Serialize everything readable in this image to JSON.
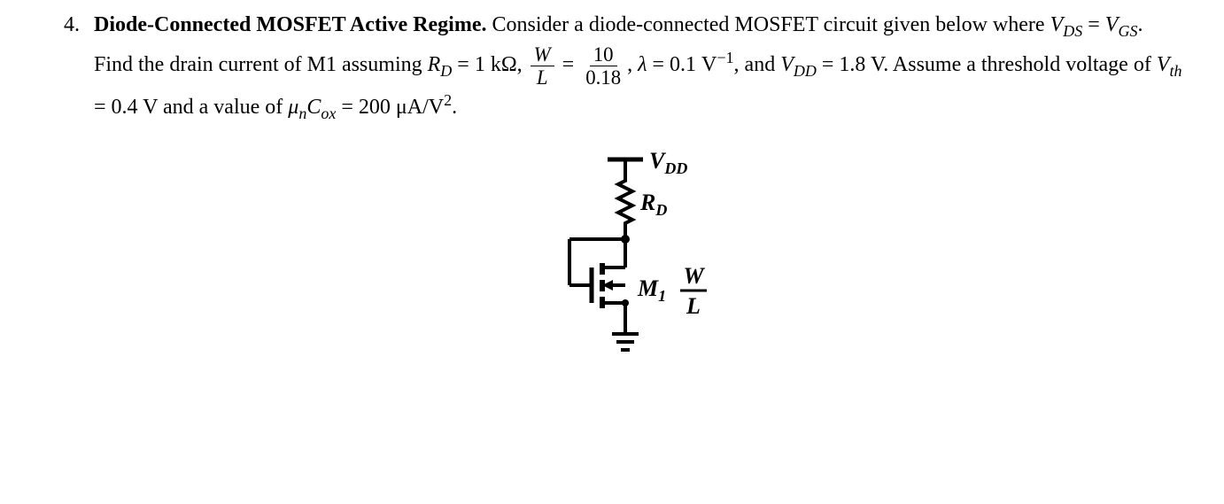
{
  "problem": {
    "number": "4.",
    "title": "Diode-Connected MOSFET Active Regime.",
    "intro_text": " Consider a diode-connected MOSFET circuit given below where ",
    "vds": "V",
    "vds_sub": "DS",
    "vgs": "V",
    "vgs_sub": "GS",
    "text2": ". Find the drain current of M1 assuming ",
    "rd": "R",
    "rd_sub": "D",
    "rd_val": " = 1 kΩ, ",
    "wl_num": "W",
    "wl_den": "L",
    "wl_eq": " = ",
    "ratio_num": "10",
    "ratio_den": "0.18",
    "text3": ", ",
    "lambda": "λ",
    "lambda_val": " = 0.1 V",
    "lambda_exp": "−1",
    "text4": ", and ",
    "vdd": "V",
    "vdd_sub": "DD",
    "vdd_val": " = 1.8 V. Assume a threshold voltage of ",
    "vth": "V",
    "vth_sub": "th",
    "vth_val": " = 0.4 V and a value of ",
    "mu": "μ",
    "mu_sub": "n",
    "cox": "C",
    "cox_sub": "ox",
    "muCox_val": " = 200 μA/V",
    "sq": "2",
    "period": "."
  },
  "circuit": {
    "vdd_label": "V",
    "vdd_sub": "DD",
    "rd_label": "R",
    "rd_sub": "D",
    "m1_label": "M",
    "m1_sub": "1",
    "w_label": "W",
    "l_label": "L"
  }
}
